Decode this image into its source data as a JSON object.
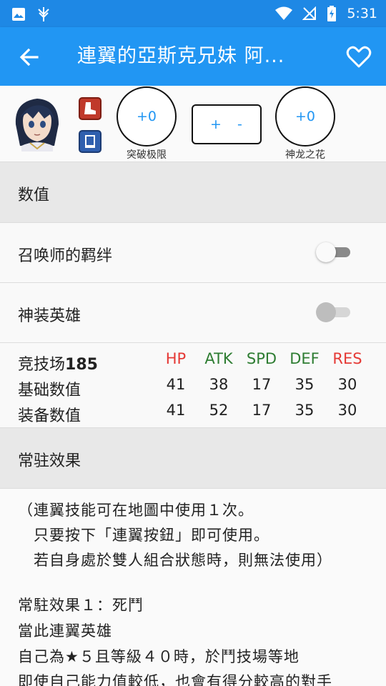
{
  "status_bar": {
    "time": "5:31",
    "icons": [
      "image-icon",
      "fire-emblem-icon",
      "wifi-icon",
      "no-signal-icon",
      "battery-charging-icon"
    ]
  },
  "app_bar": {
    "title": "連翼的亞斯克兄妹  阿...",
    "back_icon": "arrow-back-icon",
    "favorite_icon": "heart-outline-icon"
  },
  "hero": {
    "merges_value": "+0",
    "merges_label": "突破极限",
    "plus_label": "+",
    "minus_label": "-",
    "dragonflower_value": "+0",
    "dragonflower_label": "神龙之花",
    "move_type_icon": "boot-icon",
    "weapon_type_icon": "tome-icon"
  },
  "sections": {
    "stats_header": "数值",
    "summoner_support_label": "召唤师的羁绊",
    "summoner_support_on": false,
    "resplendent_label": "神装英雄",
    "resplendent_on": false,
    "passive_header": "常驻效果"
  },
  "stats": {
    "arena_label": "竞技场",
    "arena_value": "185",
    "headers": [
      "HP",
      "ATK",
      "SPD",
      "DEF",
      "RES"
    ],
    "header_colors": [
      "#e53935",
      "#2e7d32",
      "#2e7d32",
      "#2e7d32",
      "#e53935"
    ],
    "base_label": "基础数值",
    "base_values": [
      "41",
      "38",
      "17",
      "35",
      "30"
    ],
    "equip_label": "装备数值",
    "equip_values": [
      "41",
      "52",
      "17",
      "35",
      "30"
    ]
  },
  "description": {
    "lines": [
      "（連翼技能可在地圖中使用１次。",
      "　只要按下「連翼按鈕」即可使用。",
      "　若自身處於雙人組合狀態時，則無法使用）",
      "",
      "常駐效果１：死鬥",
      "當此連翼英雄",
      "自己為★５且等級４０時，於鬥技場等地",
      "即使自己能力值較低，也會有得分較高的對手"
    ]
  }
}
